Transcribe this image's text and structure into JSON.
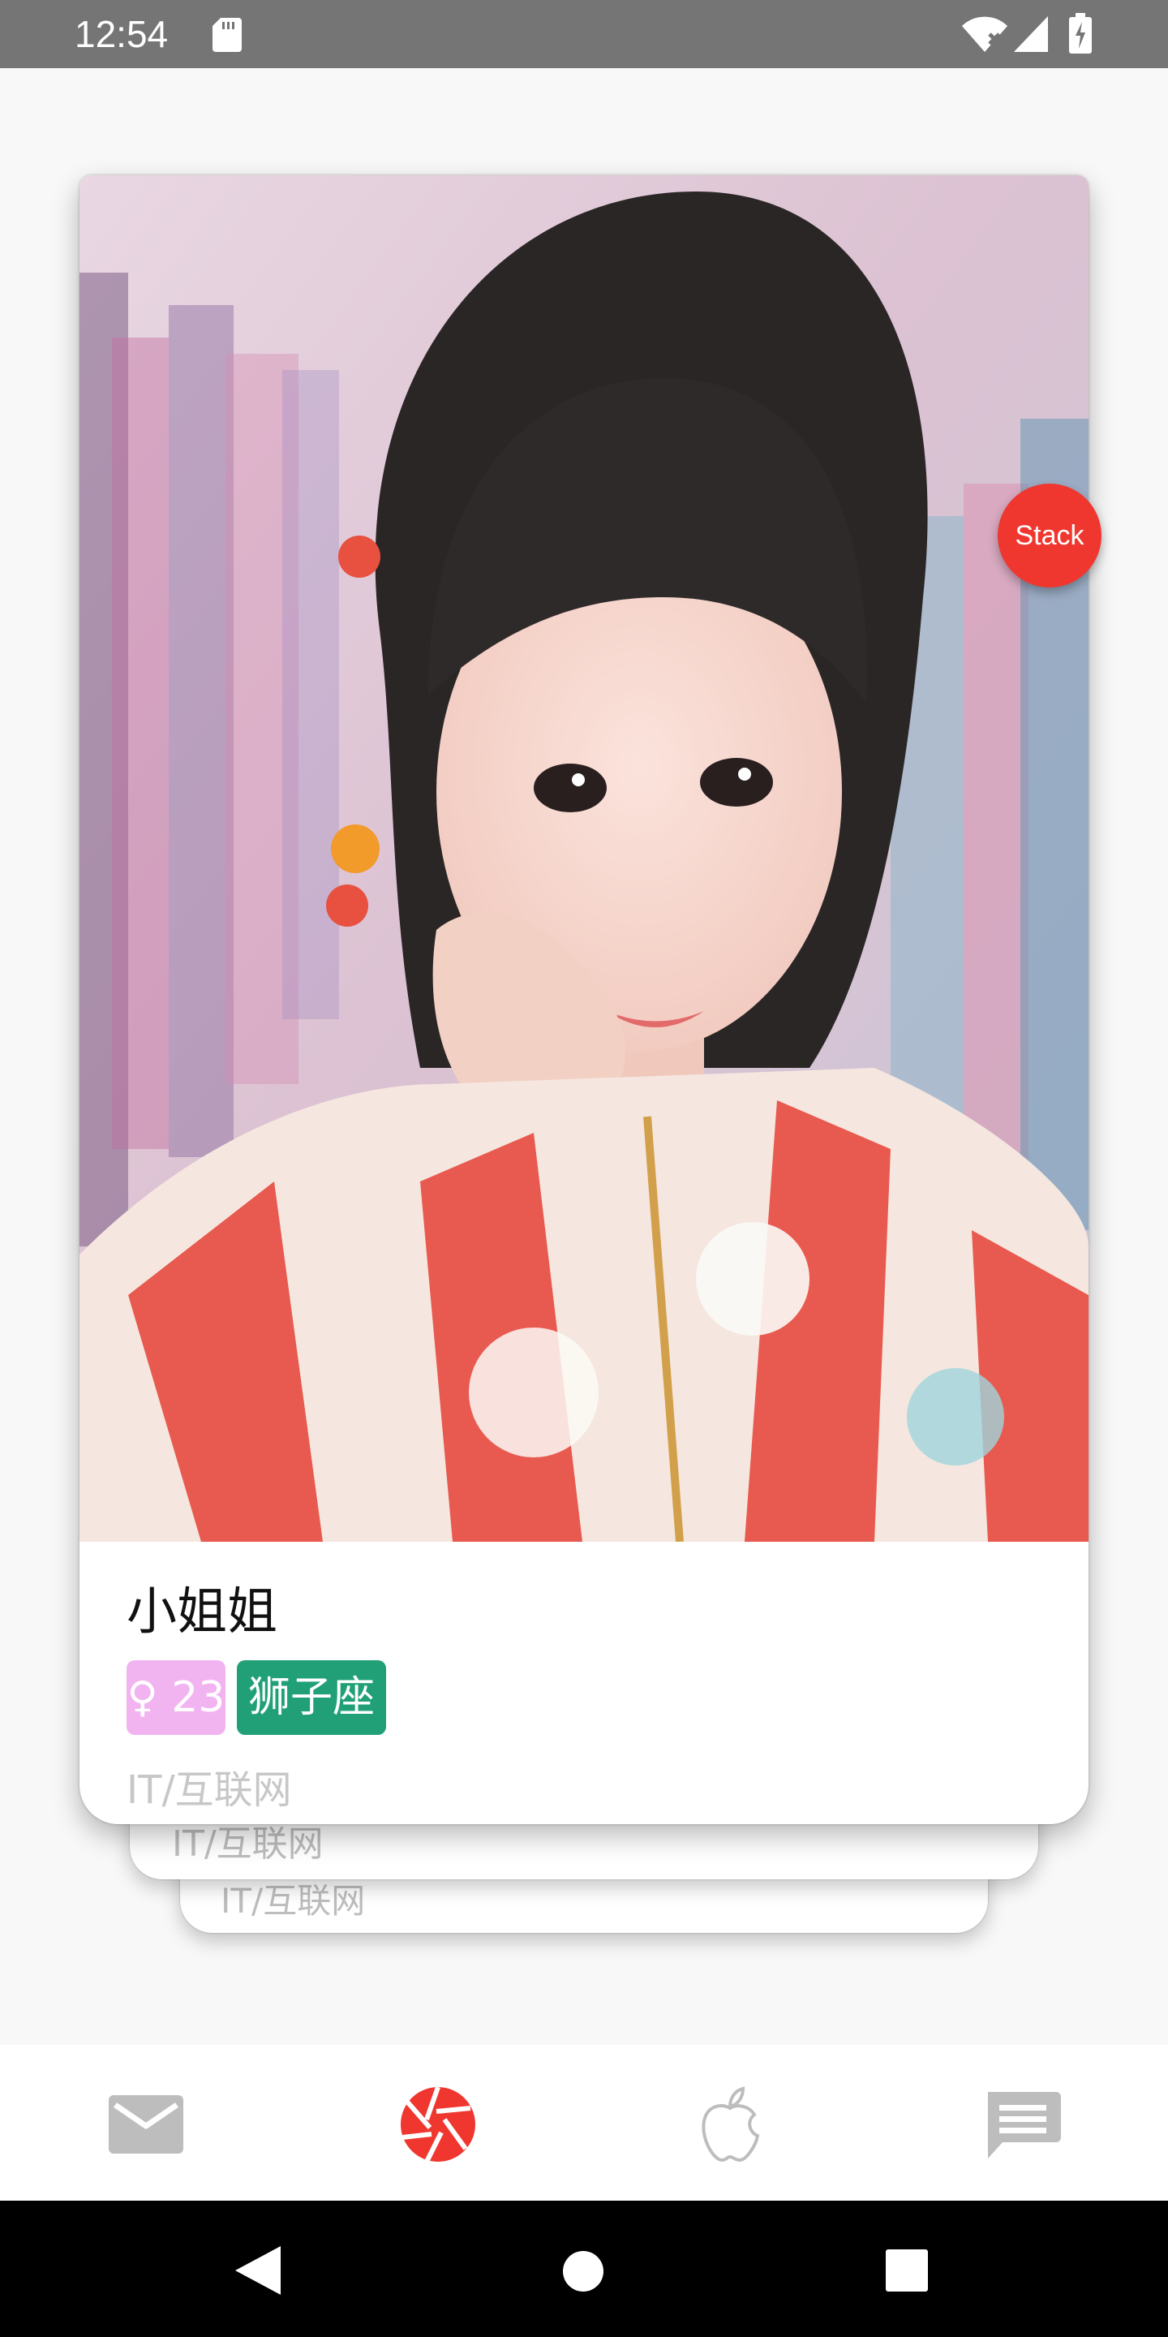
{
  "status_bar": {
    "time": "12:54",
    "icons": [
      "sd-card-icon",
      "wifi-icon",
      "signal-icon",
      "battery-charging-icon"
    ]
  },
  "card": {
    "name": "小姐姐",
    "age_tag": "♀ 23",
    "zodiac_tag": "狮子座",
    "job": "IT/互联网",
    "colors": {
      "age_tag": "#f2b3f1",
      "zodiac_tag": "#21a077"
    }
  },
  "stack_cards": [
    {
      "job": "IT/互联网"
    },
    {
      "job": "IT/互联网"
    }
  ],
  "fab": {
    "label": "Stack",
    "color": "#f0372f"
  },
  "bottom_nav": {
    "items": [
      {
        "icon": "mail-icon",
        "active": false
      },
      {
        "icon": "camera-shutter-icon",
        "active": true
      },
      {
        "icon": "apple-icon",
        "active": false
      },
      {
        "icon": "chat-icon",
        "active": false
      }
    ],
    "active_color": "#f0372f",
    "inactive_color": "#bdbdbd"
  },
  "system_nav": {
    "icons": [
      "back-icon",
      "home-icon",
      "recents-icon"
    ]
  }
}
